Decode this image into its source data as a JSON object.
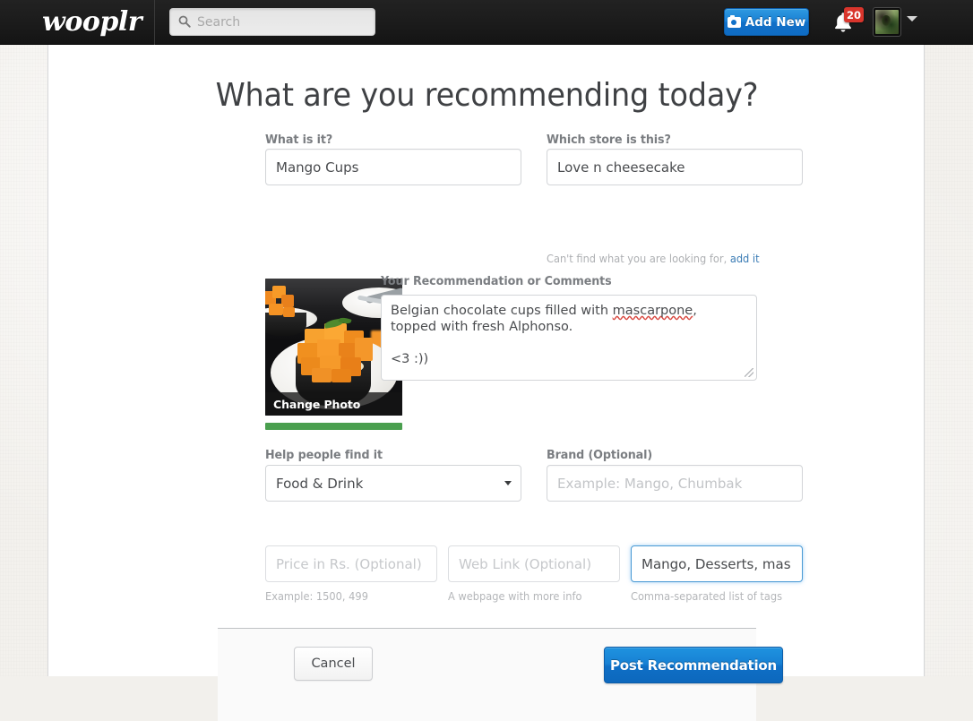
{
  "navbar": {
    "logo": "wooplr",
    "search_placeholder": "Search",
    "search_value": "",
    "add_new_label": "Add New",
    "notification_count": "20",
    "icons": {
      "search": "search-icon",
      "camera": "camera-icon",
      "bell": "bell-icon",
      "caret": "chevron-down-icon"
    }
  },
  "page": {
    "title": "What are you recommending today?"
  },
  "form": {
    "what_label": "What is it?",
    "what_value": "Mango Cups",
    "what_placeholder": "",
    "store_label": "Which store is this?",
    "store_value": "Love n cheesecake",
    "store_placeholder": "",
    "store_hint_text": "Can't find what you are looking for,",
    "store_hint_link": "add it",
    "comment_label": "Your Recommendation or Comments",
    "comment_line1_a": "Belgian chocolate cups filled with ",
    "comment_line1_b": "mascarpone",
    "comment_line1_c": ",",
    "comment_line2": "topped with fresh Alphonso.",
    "comment_line3": "",
    "comment_line4": "<3 :))",
    "change_photo_label": "Change Photo",
    "upload_progress_percent": "100",
    "category_label": "Help people find it",
    "category_value": "Food & Drink",
    "category_options": [
      "Food & Drink"
    ],
    "brand_label": "Brand (Optional)",
    "brand_value": "",
    "brand_placeholder": "Example: Mango, Chumbak",
    "price_placeholder": "Price in Rs. (Optional)",
    "price_value": "",
    "price_hint": "Example: 1500, 499",
    "link_placeholder": "Web Link (Optional)",
    "link_value": "",
    "link_hint": "A webpage with more info",
    "tags_placeholder": "",
    "tags_value": "Mango, Desserts, mas",
    "tags_hint": "Comma-separated list of tags"
  },
  "footer": {
    "cancel_label": "Cancel",
    "post_label": "Post Recommendation"
  },
  "colors": {
    "accent_blue": "#1781d4",
    "badge_red": "#d9352c",
    "progress_green": "#4a9f4f",
    "navbar_dark": "#1b1b1b",
    "link_blue": "#3b7cb5"
  }
}
